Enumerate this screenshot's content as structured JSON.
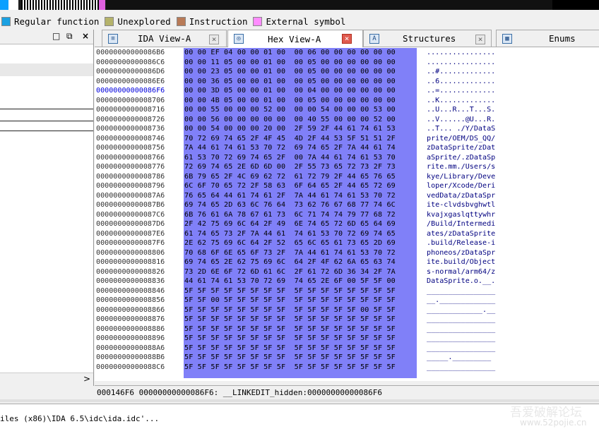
{
  "legend": [
    {
      "label": "Regular function",
      "color": "#1ba1e2"
    },
    {
      "label": "Unexplored",
      "color": "#b5b36b"
    },
    {
      "label": "Instruction",
      "color": "#b87a57"
    },
    {
      "label": "External symbol",
      "color": "#ff8cff"
    }
  ],
  "left_panel": {
    "controls": [
      "□",
      "⧉",
      "×"
    ],
    "scroll_arrow": ">"
  },
  "tabs": [
    {
      "label": "IDA View-A",
      "icon": "list-icon",
      "close": "×"
    },
    {
      "label": "Hex View-A",
      "icon": "hex-icon",
      "close": "×",
      "active": true
    },
    {
      "label": "Structures",
      "icon": "struct-icon",
      "close": "×"
    },
    {
      "label": "Enums",
      "icon": "enum-icon"
    }
  ],
  "hex": {
    "addresses": [
      "00000000000086B6",
      "00000000000086C6",
      "00000000000086D6",
      "00000000000086E6",
      "00000000000086F6",
      "0000000000008706",
      "0000000000008716",
      "0000000000008726",
      "0000000000008736",
      "0000000000008746",
      "0000000000008756",
      "0000000000008766",
      "0000000000008776",
      "0000000000008786",
      "0000000000008796",
      "00000000000087A6",
      "00000000000087B6",
      "00000000000087C6",
      "00000000000087D6",
      "00000000000087E6",
      "00000000000087F6",
      "0000000000008806",
      "0000000000008816",
      "0000000000008826",
      "0000000000008836",
      "0000000000008846",
      "0000000000008856",
      "0000000000008866",
      "0000000000008876",
      "0000000000008886",
      "0000000000008896",
      "00000000000088A6",
      "00000000000088B6",
      "00000000000088C6"
    ],
    "current_address": "00000000000086F6",
    "bytes": [
      "00 00 EF 04 00 00 01 00  00 06 00 00 00 00 00 00",
      "00 00 11 05 00 00 01 00  00 05 00 00 00 00 00 00",
      "00 00 23 05 00 00 01 00  00 05 00 00 00 00 00 00",
      "00 00 36 05 00 00 01 00  00 05 00 00 00 00 00 00",
      "00 00 3D 05 00 00 01 00  00 04 00 00 00 00 00 00",
      "00 00 4B 05 00 00 01 00  00 05 00 00 00 00 00 00",
      "00 00 55 00 00 00 52 00  00 00 54 00 00 00 53 00",
      "00 00 56 00 00 00 00 00  00 40 55 00 00 00 52 00",
      "00 00 54 00 00 00 20 00  2F 59 2F 44 61 74 61 53",
      "70 72 69 74 65 2F 4F 45  4D 2F 44 53 5F 51 51 2F",
      "7A 44 61 74 61 53 70 72  69 74 65 2F 7A 44 61 74",
      "61 53 70 72 69 74 65 2F  00 7A 44 61 74 61 53 70",
      "72 69 74 65 2E 6D 6D 00  2F 55 73 65 72 73 2F 73",
      "6B 79 65 2F 4C 69 62 72  61 72 79 2F 44 65 76 65",
      "6C 6F 70 65 72 2F 58 63  6F 64 65 2F 44 65 72 69",
      "76 65 64 44 61 74 61 2F  7A 44 61 74 61 53 70 72",
      "69 74 65 2D 63 6C 76 64  73 62 76 67 68 77 74 6C",
      "6B 76 61 6A 78 67 61 73  6C 71 74 74 79 77 68 72",
      "2F 42 75 69 6C 64 2F 49  6E 74 65 72 6D 65 64 69",
      "61 74 65 73 2F 7A 44 61  74 61 53 70 72 69 74 65",
      "2E 62 75 69 6C 64 2F 52  65 6C 65 61 73 65 2D 69",
      "70 68 6F 6E 65 6F 73 2F  7A 44 61 74 61 53 70 72",
      "69 74 65 2E 62 75 69 6C  64 2F 4F 62 6A 65 63 74",
      "73 2D 6E 6F 72 6D 61 6C  2F 61 72 6D 36 34 2F 7A",
      "44 61 74 61 53 70 72 69  74 65 2E 6F 00 5F 5F 00",
      "5F 5F 5F 5F 5F 5F 5F 5F  5F 5F 5F 5F 5F 5F 5F 5F",
      "5F 5F 00 5F 5F 5F 5F 5F  5F 5F 5F 5F 5F 5F 5F 5F",
      "5F 5F 5F 5F 5F 5F 5F 5F  5F 5F 5F 5F 5F 00 5F 5F",
      "5F 5F 5F 5F 5F 5F 5F 5F  5F 5F 5F 5F 5F 5F 5F 5F",
      "5F 5F 5F 5F 5F 5F 5F 5F  5F 5F 5F 5F 5F 5F 5F 5F",
      "5F 5F 5F 5F 5F 5F 5F 5F  5F 5F 5F 5F 5F 5F 5F 5F",
      "5F 5F 5F 5F 5F 5F 5F 5F  5F 5F 5F 5F 5F 5F 5F 5F",
      "5F 5F 5F 5F 5F 5F 5F 5F  5F 5F 5F 5F 5F 5F 5F 5F",
      "5F 5F 5F 5F 5F 5F 5F 5F  5F 5F 5F 5F 5F 5F 5F 5F"
    ],
    "ascii": [
      "................",
      "................",
      "..#.............",
      "..6.............",
      "..=.............",
      "..K.............",
      "..U...R...T...S.",
      "..V......@U...R.",
      "..T... ./Y/DataS",
      "prite/OEM/DS_QQ/",
      "zDataSprite/zDat",
      "aSprite/.zDataSp",
      "rite.mm./Users/s",
      "kye/Library/Deve",
      "loper/Xcode/Deri",
      "vedData/zDataSpr",
      "ite-clvdsbvghwtl",
      "kvajxgaslqttywhr",
      "/Build/Intermedi",
      "ates/zDataSprite",
      ".build/Release-i",
      "phoneos/zDataSpr",
      "ite.build/Object",
      "s-normal/arm64/z",
      "DataSprite.o.__.",
      "________________",
      "__._____________",
      "_____________.__",
      "________________",
      "________________",
      "________________",
      "________________",
      "_____._________",
      "________________"
    ]
  },
  "status": "000146F6 00000000000086F6: __LINKEDIT_hidden:00000000000086F6",
  "output_line": "iles (x86)\\IDA 6.5\\idc\\ida.idc'...",
  "watermark": {
    "text": "吾爱破解论坛",
    "url": "www.52pojie.cn"
  }
}
